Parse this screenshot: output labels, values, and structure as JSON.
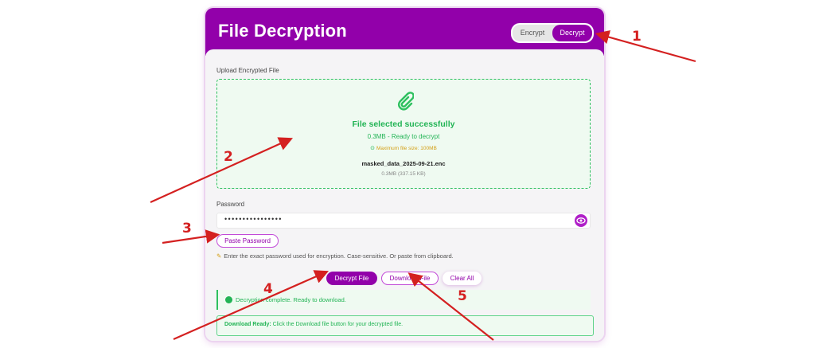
{
  "header": {
    "title": "File Decryption",
    "modes": {
      "encrypt": "Encrypt",
      "decrypt": "Decrypt",
      "active": "decrypt"
    }
  },
  "upload": {
    "label": "Upload Encrypted File",
    "status": "File selected successfully",
    "summary": "0.3MB - Ready to decrypt",
    "limit_icon": "info-circle-icon",
    "limit": "Maximum file size: 100MB",
    "file_name": "masked_data_2025-09-21.enc",
    "file_size": "0.3MB (337.15 KB)",
    "icon": "paperclip-icon"
  },
  "password": {
    "label": "Password",
    "value_masked": "••••••••••••••••",
    "toggle_icon": "eye-icon",
    "paste_label": "Paste Password",
    "hint_icon": "pencil-note-icon",
    "hint": "Enter the exact password used for encryption. Case-sensitive. Or paste from clipboard."
  },
  "actions": {
    "decrypt": "Decrypt File",
    "download": "Download File",
    "clear": "Clear All"
  },
  "messages": {
    "status": "Decryption complete. Ready to download.",
    "download_title": "Download Ready:",
    "download_body": " Click the Download file button for your decrypted file."
  },
  "annotations": [
    "1",
    "2",
    "3",
    "4",
    "5"
  ],
  "colors": {
    "brand": "#9200aa",
    "success": "#22b455",
    "warning": "#d4a017",
    "annotation": "#d42020"
  }
}
